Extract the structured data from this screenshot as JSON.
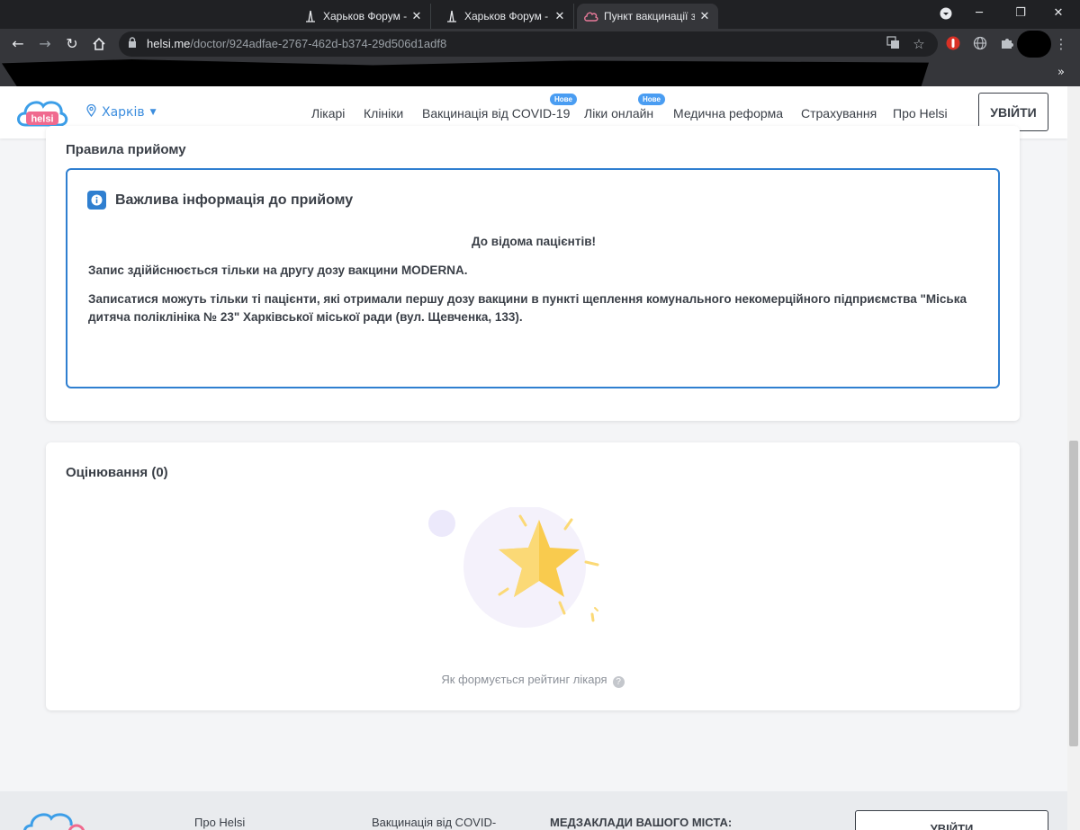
{
  "browser": {
    "tabs": [
      {
        "title": "Харьков Форум - М"
      },
      {
        "title": "Харьков Форум - С"
      },
      {
        "title": "Пункт вакцинації з"
      }
    ],
    "url_host": "helsi.me",
    "url_path": "/doctor/924adfae-2767-462d-b374-29d506d1adf8"
  },
  "header": {
    "city": "Харків",
    "nav": [
      "Лікарі",
      "Клініки",
      "Вакцинація від COVID-19",
      "Ліки онлайн",
      "Медична реформа",
      "Страхування",
      "Про Helsi"
    ],
    "badge_new": "Нове",
    "login_label": "УВІЙТИ"
  },
  "rules_card": {
    "title": "Правила прийому",
    "info_heading": "Важлива інформація до прийому",
    "notice_title": "До відома пацієнтів!",
    "paragraph1": "Запис  здіййснюється тільки на другу дозу вакцини MODERNA.",
    "paragraph2": "Записатися можуть  тільки ті пацієнти, які отримали першу дозу вакцини в пункті щеплення комунального некомерційного підприємства \"Міська дитяча поліклініка № 23\" Харківської міської ради (вул. Щевченка, 133)."
  },
  "rating_card": {
    "title": "Оцінювання (0)",
    "note": "Як формується рейтинг лікаря"
  },
  "footer": {
    "about": "Про Helsi",
    "vaccination": "Вакцинація від COVID-",
    "clinics_heading": "МЕДЗАКЛАДИ ВАШОГО МІСТА:",
    "login_label": "УВІЙТИ"
  },
  "colors": {
    "accent": "#2f7fd0",
    "star": "#f9cb4e"
  }
}
